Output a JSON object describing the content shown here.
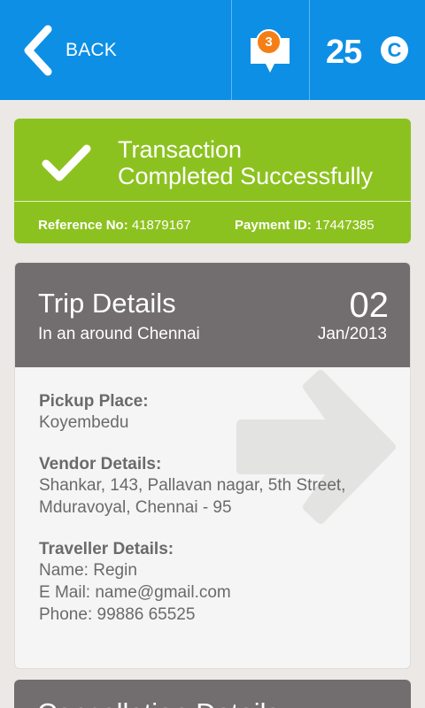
{
  "header": {
    "back_label": "BACK",
    "notification_count": "3",
    "credits": "25",
    "credit_symbol": "C",
    "color": "#0d8fe6"
  },
  "status": {
    "title_line1": "Transaction",
    "title_line2": "Completed Successfully",
    "reference_label": "Reference No:",
    "reference_value": "41879167",
    "payment_label": "Payment ID:",
    "payment_value": "17447385",
    "color": "#8cc21f"
  },
  "trip": {
    "title": "Trip Details",
    "subtitle": "In an around Chennai",
    "day": "02",
    "month_year": "Jan/2013",
    "pickup_label": "Pickup Place:",
    "pickup_value": "Koyembedu",
    "vendor_label": "Vendor Details:",
    "vendor_line1": "Shankar, 143, Pallavan nagar, 5th Street,",
    "vendor_line2": "Mduravoyal, Chennai - 95",
    "traveller_label": "Traveller Details:",
    "traveller_name": "Name: Regin",
    "traveller_email": "E Mail: name@gmail.com",
    "traveller_phone": "Phone: 99886 65525",
    "header_color": "#726d6e"
  },
  "cancellation": {
    "title": "Cancellation Details"
  },
  "icons": [
    "back-arrow-icon",
    "message-bubble-icon",
    "coin-icon",
    "checkmark-icon",
    "arrow-watermark-icon"
  ]
}
